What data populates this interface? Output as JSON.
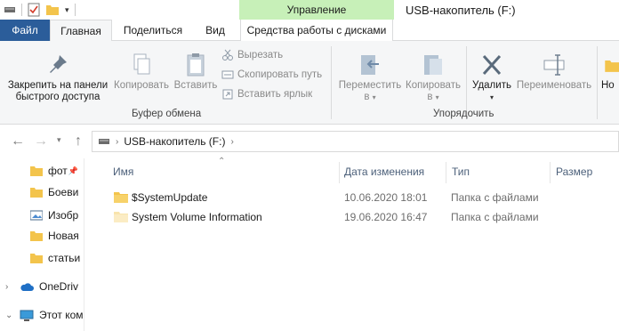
{
  "window": {
    "title": "USB-накопитель (F:)",
    "context_group": "Управление"
  },
  "tabs": {
    "file": "Файл",
    "home": "Главная",
    "share": "Поделиться",
    "view": "Вид",
    "disk_tools": "Средства работы с дисками"
  },
  "ribbon": {
    "clipboard": {
      "pin_line1": "Закрепить на панели",
      "pin_line2": "быстрого доступа",
      "copy": "Копировать",
      "paste": "Вставить",
      "cut": "Вырезать",
      "copy_path": "Скопировать путь",
      "paste_shortcut": "Вставить ярлык",
      "group_label": "Буфер обмена"
    },
    "organize": {
      "move_line1": "Переместить",
      "move_line2": "в",
      "copy_to_line1": "Копировать",
      "copy_to_line2": "в",
      "delete": "Удалить",
      "rename": "Переименовать",
      "group_label": "Упорядочить"
    },
    "new_partial": "Но"
  },
  "address": {
    "location": "USB-накопитель (F:)"
  },
  "navpane": {
    "items": [
      {
        "label": "фот"
      },
      {
        "label": "Боеви"
      },
      {
        "label": "Изобр"
      },
      {
        "label": "Новая"
      },
      {
        "label": "статьи"
      },
      {
        "label": "OneDriv"
      },
      {
        "label": "Этот ком"
      }
    ]
  },
  "columns": {
    "name": "Имя",
    "date": "Дата изменения",
    "type": "Тип",
    "size": "Размер"
  },
  "files": [
    {
      "name": "$SystemUpdate",
      "date": "10.06.2020 18:01",
      "type": "Папка с файлами"
    },
    {
      "name": "System Volume Information",
      "date": "19.06.2020 16:47",
      "type": "Папка с файлами"
    }
  ],
  "colors": {
    "file_tab": "#2b5d9a",
    "context_tab": "#c7f0b8",
    "folder": "#f3c44c",
    "accent_blue": "#1f6fc5"
  }
}
